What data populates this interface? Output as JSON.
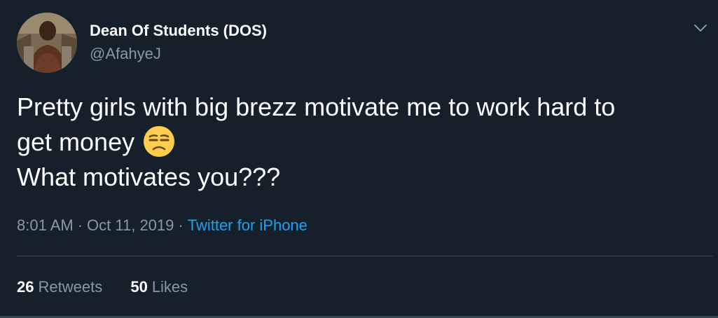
{
  "user": {
    "display_name": "Dean Of Students (DOS)",
    "handle": "@AfahyeJ"
  },
  "tweet": {
    "line1": "Pretty girls with big brezz motivate me to work hard to",
    "line2": "get money",
    "emoji": "unamused-face-icon",
    "line3": "What motivates you???"
  },
  "meta": {
    "time": "8:01 AM",
    "separator": "·",
    "date": "Oct 11, 2019",
    "source": "Twitter for iPhone"
  },
  "stats": {
    "retweets_count": "26",
    "retweets_label": "Retweets",
    "likes_count": "50",
    "likes_label": "Likes"
  },
  "colors": {
    "background": "#15202b",
    "secondary_text": "#8899a6",
    "link": "#1da1f2",
    "divider": "#38444d"
  }
}
